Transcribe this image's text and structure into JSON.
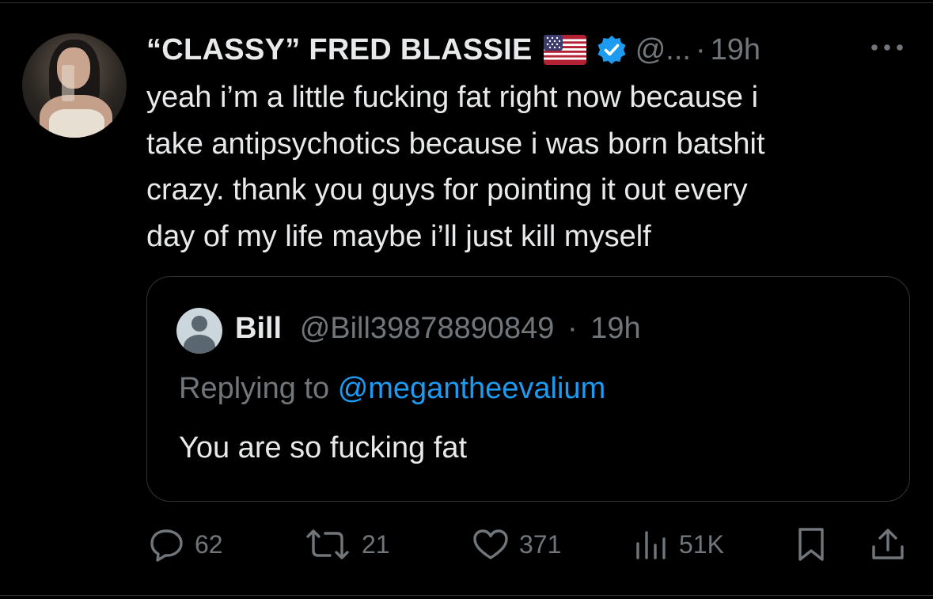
{
  "author": {
    "display_name": "“CLASSY” FRED BLASSIE",
    "handle": "@...",
    "separator": "·",
    "time": "19h",
    "flag_icon": "us-flag-icon",
    "verified_icon": "verified-badge-icon"
  },
  "tweet": {
    "lines": [
      "yeah i’m a little fucking fat right now because i",
      "take antipsychotics because i was born batshit",
      "crazy. thank you guys for pointing it out every",
      "day of my life maybe i’ll just kill myself"
    ]
  },
  "quote": {
    "name": "Bill",
    "handle": "@Bill39878890849",
    "separator": "·",
    "time": "19h",
    "replying_prefix": "Replying to",
    "replying_mention": "@megantheevalium",
    "text": "You are so fucking fat"
  },
  "actions": {
    "replies": "62",
    "reposts": "21",
    "likes": "371",
    "views": "51K"
  },
  "colors": {
    "background": "#000000",
    "text": "#e7e9ea",
    "muted": "#71767b",
    "accent": "#1d9bf0",
    "border": "#2f3336"
  }
}
